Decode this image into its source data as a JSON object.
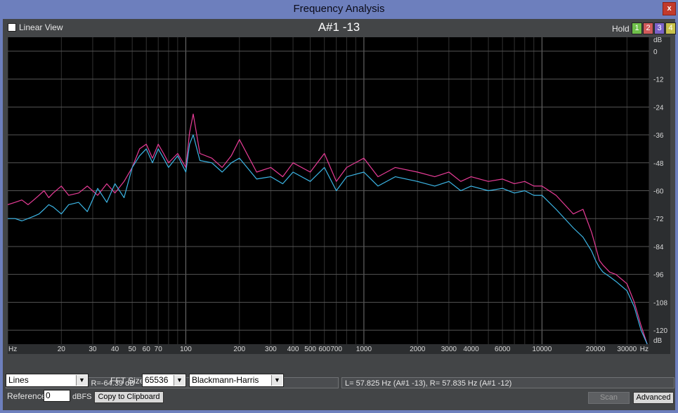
{
  "window": {
    "title": "Frequency Analysis",
    "close_label": "x"
  },
  "top": {
    "linear_view_label": "Linear View",
    "note": "A#1 -13",
    "hold_label": "Hold",
    "hold_buttons": [
      {
        "label": "1",
        "color": "#6fbf4a"
      },
      {
        "label": "2",
        "color": "#d05a5a"
      },
      {
        "label": "3",
        "color": "#7b62c8"
      },
      {
        "label": "4",
        "color": "#c8c24a"
      }
    ]
  },
  "chart_data": {
    "type": "line",
    "x_scale": "log",
    "xlim": [
      10,
      40000
    ],
    "ylim": [
      -126,
      6
    ],
    "x_ticks": [
      20,
      30,
      40,
      50,
      60,
      70,
      100,
      200,
      300,
      400,
      500,
      600,
      700,
      1000,
      2000,
      3000,
      4000,
      6000,
      10000,
      20000,
      30000
    ],
    "x_tick_labels": [
      "20",
      "30",
      "40",
      "50",
      "60",
      "70",
      "100",
      "200",
      "300",
      "400",
      "500",
      "600",
      "700",
      "1000",
      "2000",
      "3000",
      "4000",
      "6000",
      "10000",
      "20000",
      "30000"
    ],
    "y_ticks": [
      0,
      -12,
      -24,
      -36,
      -48,
      -60,
      -72,
      -84,
      -96,
      -108,
      -120
    ],
    "y_tick_labels": [
      "0",
      "-12",
      "-24",
      "-36",
      "-48",
      "-60",
      "-72",
      "-84",
      "-96",
      "-108",
      "-120"
    ],
    "x_unit_left": "Hz",
    "x_unit_right": "Hz",
    "y_unit_top": "dB",
    "y_unit_bottom": "dB",
    "grid": true,
    "series": [
      {
        "color": "#e83c97",
        "x": [
          10,
          11,
          12,
          13,
          14,
          15,
          16,
          17,
          18,
          20,
          22,
          25,
          28,
          32,
          36,
          40,
          45,
          50,
          55,
          60,
          65,
          70,
          75,
          80,
          90,
          100,
          105,
          110,
          120,
          140,
          160,
          180,
          200,
          250,
          300,
          350,
          400,
          500,
          600,
          700,
          800,
          1000,
          1200,
          1500,
          2000,
          2500,
          3000,
          3500,
          4000,
          5000,
          6000,
          7000,
          8000,
          9000,
          10000,
          12000,
          15000,
          17000,
          19000,
          20000,
          21000,
          22000,
          24000,
          26000,
          30000,
          33000,
          36000,
          39000
        ],
        "values": [
          -66,
          -65,
          -64,
          -66,
          -64,
          -62,
          -60,
          -63,
          -61,
          -58,
          -62,
          -61,
          -58,
          -62,
          -57,
          -61,
          -56,
          -50,
          -42,
          -40,
          -46,
          -40,
          -44,
          -48,
          -44,
          -50,
          -35,
          -27,
          -44,
          -46,
          -50,
          -45,
          -38,
          -52,
          -50,
          -54,
          -48,
          -52,
          -44,
          -56,
          -50,
          -46,
          -54,
          -50,
          -52,
          -54,
          -52,
          -56,
          -54,
          -56,
          -55,
          -57,
          -56,
          -58,
          -58,
          -62,
          -70,
          -68,
          -78,
          -84,
          -90,
          -92,
          -95,
          -96,
          -100,
          -108,
          -118,
          -126
        ]
      },
      {
        "color": "#3cb6e6",
        "x": [
          10,
          11,
          12,
          13,
          14,
          15,
          16,
          17,
          18,
          20,
          22,
          25,
          28,
          32,
          36,
          40,
          45,
          50,
          55,
          60,
          65,
          70,
          75,
          80,
          90,
          100,
          105,
          110,
          120,
          140,
          160,
          180,
          200,
          250,
          300,
          350,
          400,
          500,
          600,
          700,
          800,
          1000,
          1200,
          1500,
          2000,
          2500,
          3000,
          3500,
          4000,
          5000,
          6000,
          7000,
          8000,
          9000,
          10000,
          12000,
          15000,
          17000,
          19000,
          20000,
          21000,
          22000,
          24000,
          26000,
          30000,
          33000,
          36000,
          39000
        ],
        "values": [
          -72,
          -72,
          -73,
          -72,
          -71,
          -70,
          -68,
          -66,
          -67,
          -70,
          -66,
          -65,
          -69,
          -59,
          -65,
          -57,
          -63,
          -50,
          -45,
          -42,
          -48,
          -42,
          -46,
          -50,
          -45,
          -52,
          -40,
          -36,
          -47,
          -48,
          -52,
          -48,
          -46,
          -55,
          -54,
          -57,
          -52,
          -56,
          -50,
          -60,
          -54,
          -52,
          -58,
          -54,
          -56,
          -58,
          -56,
          -60,
          -58,
          -60,
          -59,
          -61,
          -60,
          -62,
          -62,
          -68,
          -76,
          -80,
          -86,
          -90,
          -93,
          -95,
          -97,
          -99,
          -103,
          -110,
          -120,
          -126
        ]
      }
    ]
  },
  "status": {
    "left": "10.25 Hz, L=-72.44 dB, R=-64.39 dB",
    "right": "L= 57.825 Hz (A#1 -13), R= 57.835 Hz (A#1 -12)"
  },
  "controls": {
    "mode": "Lines",
    "fft_size_label": "FFT Size",
    "fft_size": "65536",
    "window": "Blackmann-Harris",
    "reference_label": "Reference",
    "reference_value": "0",
    "dbfs_label": "dBFS",
    "copy_button": "Copy to Clipboard",
    "scan_button": "Scan",
    "advanced_button": "Advanced"
  }
}
